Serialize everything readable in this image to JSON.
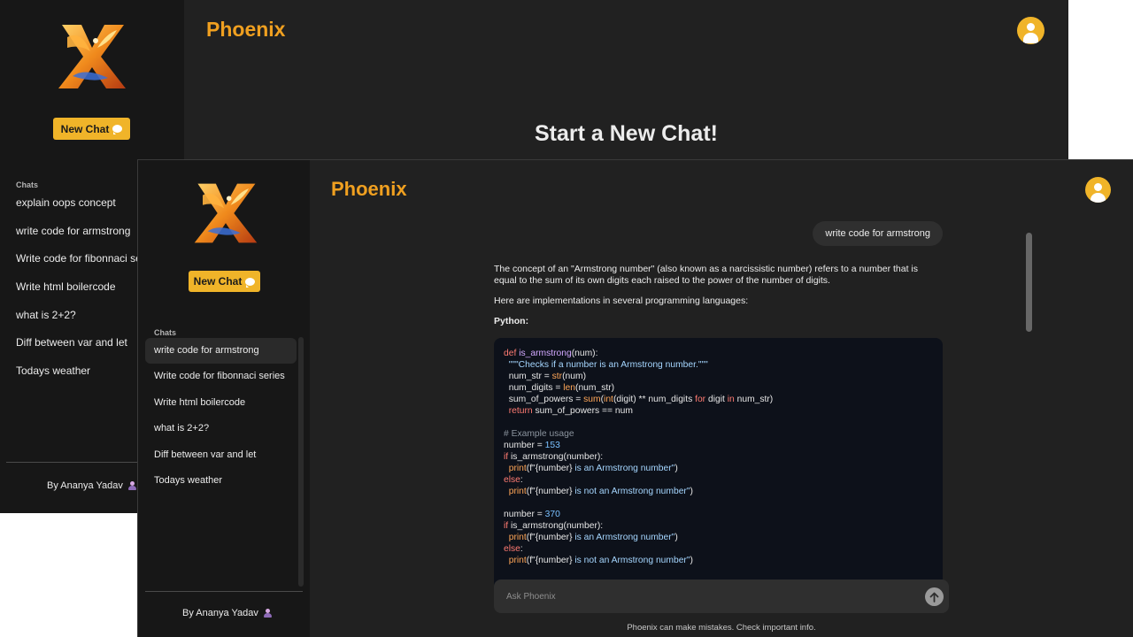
{
  "app": {
    "title": "Phoenix",
    "new_chat_label": "New Chat",
    "chats_label": "Chats",
    "credit": "By Ananya Yadav",
    "accent_color": "#f0a020"
  },
  "back_window": {
    "heading": "Start a New Chat!",
    "chats": [
      "explain oops concept",
      "write code for armstrong",
      "Write code for fibonnaci series",
      "Write html boilercode",
      "what is 2+2?",
      "Diff between var and let",
      "Todays weather"
    ]
  },
  "front_window": {
    "chats": [
      "write code for armstrong",
      "Write code for fibonnaci series",
      "Write html boilercode",
      "what is 2+2?",
      "Diff between var and let",
      "Todays weather"
    ],
    "user_message": "write code for armstrong",
    "answer": {
      "p1": "The concept of an \"Armstrong number\" (also known as a narcissistic number) refers to a number that is equal to the sum of its own digits each raised to the power of the number of digits.",
      "p2": "Here are implementations in several programming languages:",
      "lang": "Python:"
    },
    "code": [
      {
        "t": "def ",
        "c": "kw"
      },
      {
        "t": "is_armstrong",
        "c": "fn"
      },
      {
        "t": "(num):",
        "c": ""
      },
      {
        "br": 1
      },
      {
        "t": "  \"\"\"Checks if a number is an Armstrong number.\"\"\"",
        "c": "str"
      },
      {
        "br": 1
      },
      {
        "t": "  num_str = ",
        "c": ""
      },
      {
        "t": "str",
        "c": "bi"
      },
      {
        "t": "(num)",
        "c": ""
      },
      {
        "br": 1
      },
      {
        "t": "  num_digits = ",
        "c": ""
      },
      {
        "t": "len",
        "c": "bi"
      },
      {
        "t": "(num_str)",
        "c": ""
      },
      {
        "br": 1
      },
      {
        "t": "  sum_of_powers = ",
        "c": ""
      },
      {
        "t": "sum",
        "c": "bi"
      },
      {
        "t": "(",
        "c": ""
      },
      {
        "t": "int",
        "c": "bi"
      },
      {
        "t": "(digit) ** num_digits ",
        "c": ""
      },
      {
        "t": "for",
        "c": "kw"
      },
      {
        "t": " digit ",
        "c": ""
      },
      {
        "t": "in",
        "c": "kw"
      },
      {
        "t": " num_str)",
        "c": ""
      },
      {
        "br": 1
      },
      {
        "t": "  ",
        "c": ""
      },
      {
        "t": "return",
        "c": "kw"
      },
      {
        "t": " sum_of_powers == num",
        "c": ""
      },
      {
        "br": 1
      },
      {
        "br": 1
      },
      {
        "t": "# Example usage",
        "c": "cm"
      },
      {
        "br": 1
      },
      {
        "t": "number = ",
        "c": ""
      },
      {
        "t": "153",
        "c": "num"
      },
      {
        "br": 1
      },
      {
        "t": "if",
        "c": "kw"
      },
      {
        "t": " is_armstrong(number):",
        "c": ""
      },
      {
        "br": 1
      },
      {
        "t": "  ",
        "c": ""
      },
      {
        "t": "print",
        "c": "bi"
      },
      {
        "t": "(f\"",
        "c": ""
      },
      {
        "t": "{number}",
        "c": ""
      },
      {
        "t": " is an Armstrong number\"",
        "c": "str"
      },
      {
        "t": ")",
        "c": ""
      },
      {
        "br": 1
      },
      {
        "t": "else",
        "c": "kw"
      },
      {
        "t": ":",
        "c": ""
      },
      {
        "br": 1
      },
      {
        "t": "  ",
        "c": ""
      },
      {
        "t": "print",
        "c": "bi"
      },
      {
        "t": "(f\"",
        "c": ""
      },
      {
        "t": "{number}",
        "c": ""
      },
      {
        "t": " is not an Armstrong number\"",
        "c": "str"
      },
      {
        "t": ")",
        "c": ""
      },
      {
        "br": 1
      },
      {
        "br": 1
      },
      {
        "t": "number = ",
        "c": ""
      },
      {
        "t": "370",
        "c": "num"
      },
      {
        "br": 1
      },
      {
        "t": "if",
        "c": "kw"
      },
      {
        "t": " is_armstrong(number):",
        "c": ""
      },
      {
        "br": 1
      },
      {
        "t": "  ",
        "c": ""
      },
      {
        "t": "print",
        "c": "bi"
      },
      {
        "t": "(f\"",
        "c": ""
      },
      {
        "t": "{number}",
        "c": ""
      },
      {
        "t": " is an Armstrong number\"",
        "c": "str"
      },
      {
        "t": ")",
        "c": ""
      },
      {
        "br": 1
      },
      {
        "t": "else",
        "c": "kw"
      },
      {
        "t": ":",
        "c": ""
      },
      {
        "br": 1
      },
      {
        "t": "  ",
        "c": ""
      },
      {
        "t": "print",
        "c": "bi"
      },
      {
        "t": "(f\"",
        "c": ""
      },
      {
        "t": "{number}",
        "c": ""
      },
      {
        "t": " is not an Armstrong number\"",
        "c": "str"
      },
      {
        "t": ")",
        "c": ""
      }
    ],
    "input_placeholder": "Ask Phoenix",
    "disclaimer": "Phoenix can make mistakes. Check important info."
  }
}
